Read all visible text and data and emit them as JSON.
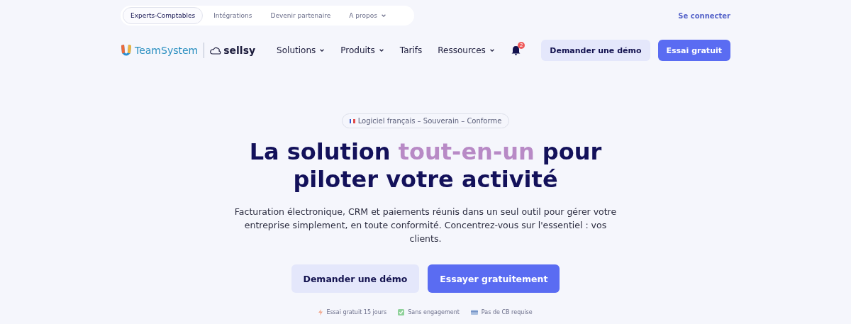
{
  "top_links": [
    {
      "label": "Experts-Comptables",
      "selected": true
    },
    {
      "label": "Intégrations",
      "selected": false
    },
    {
      "label": "Devenir partenaire",
      "selected": false
    },
    {
      "label": "A propos",
      "selected": false,
      "dropdown": true
    }
  ],
  "login": "Se connecter",
  "logo": {
    "brand": "TeamSystem",
    "product": "sellsy"
  },
  "nav": [
    {
      "label": "Solutions",
      "dropdown": true
    },
    {
      "label": "Produits",
      "dropdown": true
    },
    {
      "label": "Tarifs",
      "dropdown": false
    },
    {
      "label": "Ressources",
      "dropdown": true
    }
  ],
  "notifications": "2",
  "header_buttons": [
    {
      "label": "Demander une démo",
      "kind": "secondary"
    },
    {
      "label": "Essai gratuit",
      "kind": "primary"
    }
  ],
  "badge": "Logiciel français – Souverain – Conforme",
  "title": {
    "before": "La solution ",
    "highlight": "tout-en-un",
    "after": " pour piloter votre activité"
  },
  "description": "Facturation électronique, CRM et paiements réunis dans un seul outil pour gérer votre entreprise simplement, en toute conformité. Concentrez-vous sur l'essentiel : vos clients.",
  "cta": [
    {
      "label": "Demander une démo",
      "kind": "secondary"
    },
    {
      "label": "Essayer gratuitement",
      "kind": "primary"
    }
  ],
  "perks": [
    {
      "label": "Essai gratuit 15 jours",
      "kind": "lightning"
    },
    {
      "label": "Sans engagement",
      "kind": "check"
    },
    {
      "label": "Pas de CB requise",
      "kind": "card"
    }
  ]
}
